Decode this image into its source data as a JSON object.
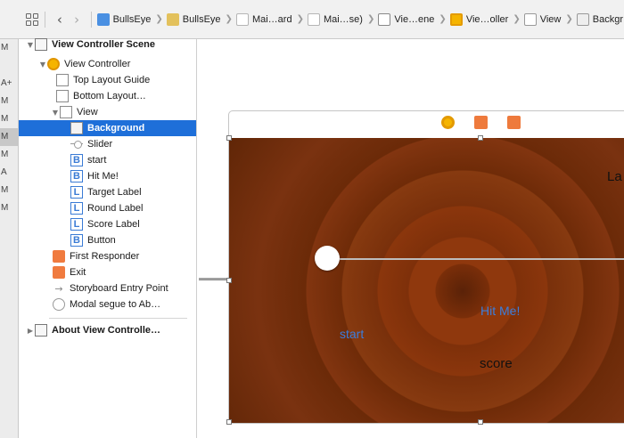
{
  "jumpbar": {
    "crumbs": [
      {
        "label": "BullsEye",
        "icon": "app-icon"
      },
      {
        "label": "BullsEye",
        "icon": "folder-icon"
      },
      {
        "label": "Mai…ard",
        "icon": "storyboard-file-icon"
      },
      {
        "label": "Mai…se)",
        "icon": "storyboard-file-icon"
      },
      {
        "label": "Vie…ene",
        "icon": "scene-icon"
      },
      {
        "label": "Vie…oller",
        "icon": "view-controller-icon"
      },
      {
        "label": "View",
        "icon": "view-icon"
      },
      {
        "label": "Backgr",
        "icon": "image-view-icon"
      }
    ]
  },
  "left_strip": [
    "M",
    "",
    "A+",
    "M",
    "M",
    "M",
    "M",
    "A",
    "M",
    "M"
  ],
  "outline": {
    "scene1": "View Controller Scene",
    "vc": "View Controller",
    "top_guide": "Top Layout Guide",
    "bottom_guide": "Bottom Layout…",
    "view": "View",
    "background": "Background",
    "slider": "Slider",
    "start": "start",
    "hitme": "Hit Me!",
    "target_label": "Target Label",
    "round_label": "Round Label",
    "score_label": "Score Label",
    "button": "Button",
    "first_responder": "First Responder",
    "exit": "Exit",
    "entry_point": "Storyboard Entry Point",
    "modal_segue": "Modal segue to Ab…",
    "scene2": "About View Controlle…"
  },
  "canvas": {
    "hit_me": "Hit Me!",
    "start": "start",
    "score": "score",
    "la": "La"
  },
  "colors": {
    "selection": "#1e6fd9",
    "button_blue": "#3b7ddd",
    "accent_orange": "#ee7a3c"
  }
}
